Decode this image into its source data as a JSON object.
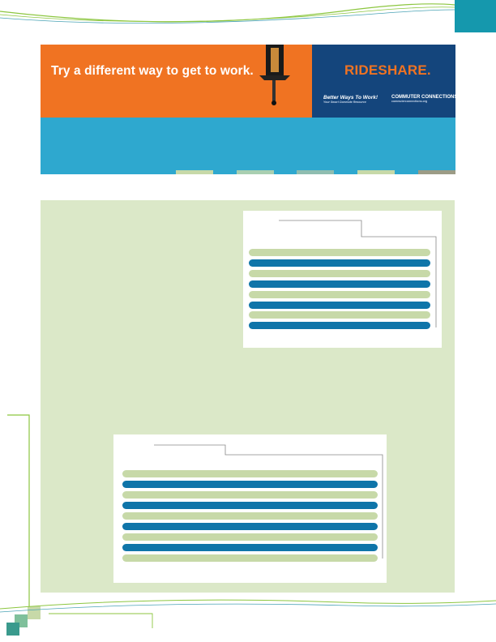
{
  "banner": {
    "tagline": "Try a different way to get to work.",
    "headline": "RIDESHARE.",
    "logo_left": "Better Ways To Work!",
    "logo_right": "COMMUTER CONNECTIONS",
    "logo_left_sub": "Your Smart Commute Resource",
    "logo_right_sub": "commuterconnections.org"
  },
  "colors": {
    "orange": "#f07322",
    "navy": "#14457c",
    "sky": "#2ea8cf",
    "panel_green": "#dbe8c8",
    "row_green": "#c7d9a8",
    "row_blue": "#0f75a9",
    "teal": "#1598ad"
  },
  "table_a": {
    "rows": [
      "green",
      "blue",
      "green",
      "blue",
      "green",
      "blue",
      "green",
      "blue"
    ]
  },
  "table_b": {
    "rows": [
      "green",
      "blue",
      "green",
      "blue",
      "green",
      "blue",
      "green",
      "blue",
      "green"
    ]
  }
}
